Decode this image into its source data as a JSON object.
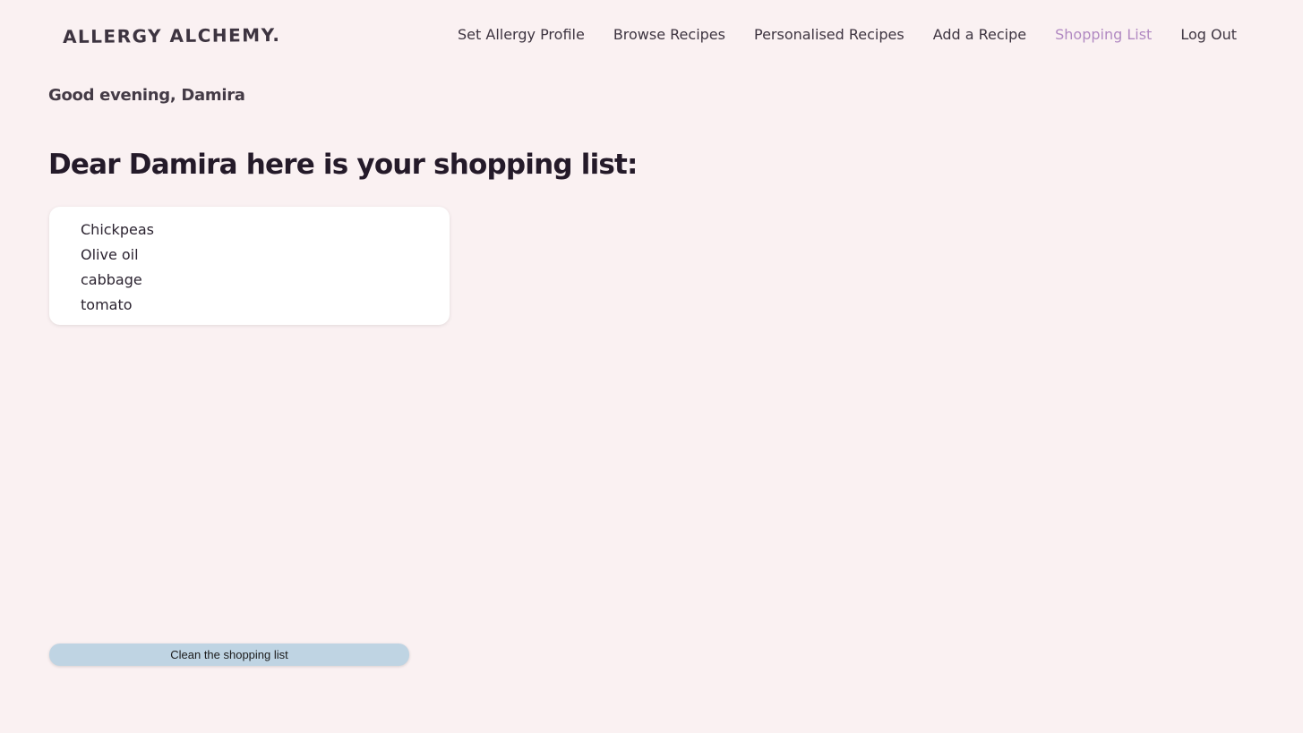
{
  "header": {
    "logo": "ALLERGY ALCHEMY.",
    "nav": [
      {
        "label": "Set Allergy Profile",
        "active": false
      },
      {
        "label": "Browse Recipes",
        "active": false
      },
      {
        "label": "Personalised Recipes",
        "active": false
      },
      {
        "label": "Add a Recipe",
        "active": false
      },
      {
        "label": "Shopping List",
        "active": true
      },
      {
        "label": "Log Out",
        "active": false
      }
    ]
  },
  "main": {
    "greeting": "Good evening, Damira",
    "heading": "Dear Damira here is your shopping list:",
    "shopping_list": [
      "Chickpeas",
      "Olive oil",
      "cabbage",
      "tomato"
    ],
    "clean_button_label": "Clean the shopping list"
  },
  "colors": {
    "background": "#faf1f2",
    "active_nav": "#b189c2",
    "button": "#bfd4e3"
  }
}
